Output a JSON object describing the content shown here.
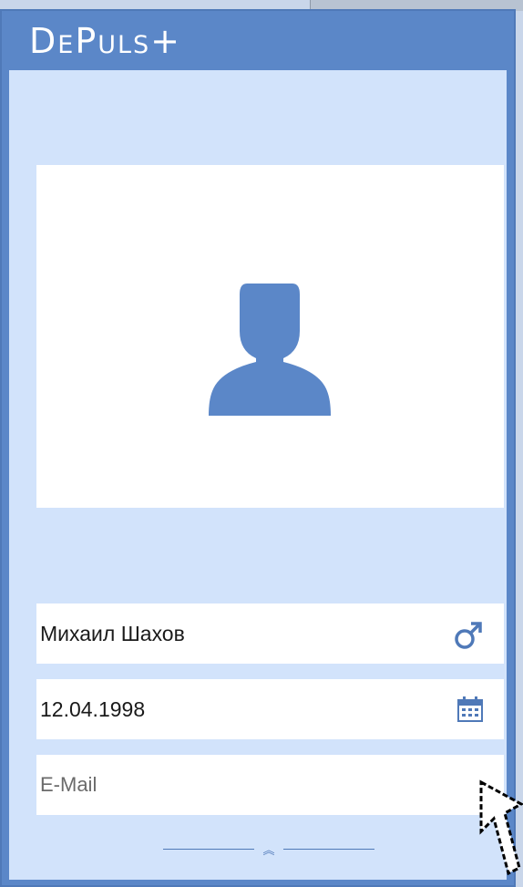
{
  "app": {
    "logo_text": "DePuls+"
  },
  "profile": {
    "avatar_icon": "user-silhouette-icon",
    "name": "Михаил Шахов",
    "gender_icon": "male-icon",
    "birth_date": "12.04.1998",
    "calendar_icon": "calendar-icon",
    "email_placeholder": "E-Mail",
    "email_value": ""
  },
  "colors": {
    "accent": "#5b87c8",
    "panel_bg": "#d2e3fb"
  }
}
